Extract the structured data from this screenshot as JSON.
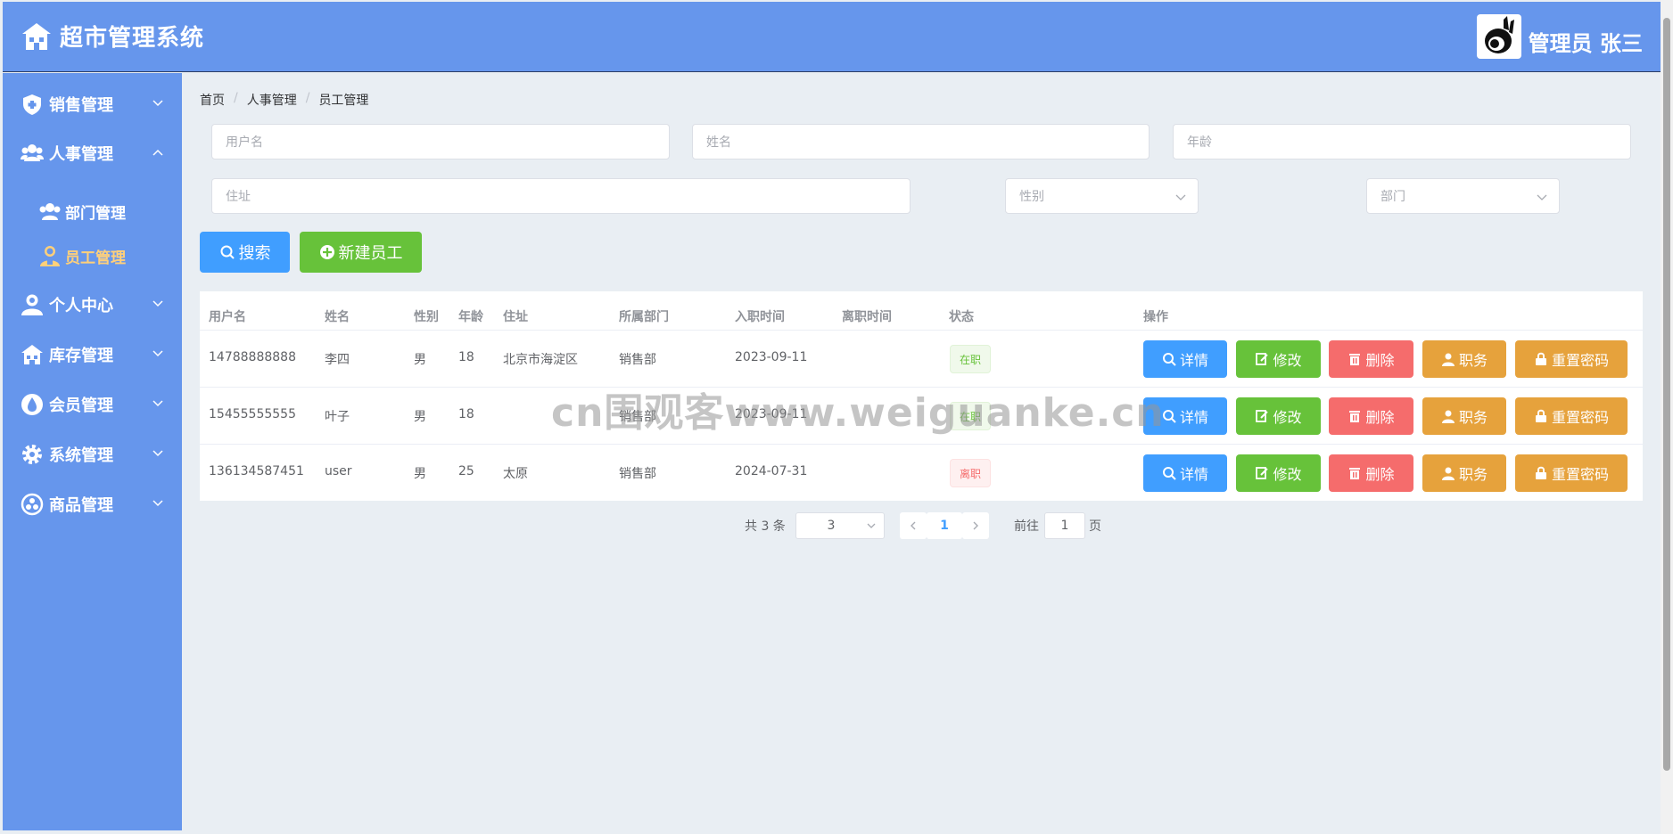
{
  "header": {
    "title": "超市管理系统",
    "user_name": "管理员 张三",
    "home_icon": "home-icon",
    "avatar_icon": "penguin-avatar"
  },
  "sidebar": {
    "items": [
      {
        "label": "销售管理",
        "icon": "shield-icon"
      },
      {
        "label": "人事管理",
        "icon": "people-icon"
      },
      {
        "label": "个人中心",
        "icon": "user-icon"
      },
      {
        "label": "库存管理",
        "icon": "warehouse-icon"
      },
      {
        "label": "会员管理",
        "icon": "drop-icon"
      },
      {
        "label": "系统管理",
        "icon": "gear-icon"
      },
      {
        "label": "商品管理",
        "icon": "goods-icon"
      }
    ],
    "sub_items": [
      {
        "label": "部门管理",
        "icon": "group-icon"
      },
      {
        "label": "员工管理",
        "icon": "employee-icon"
      }
    ]
  },
  "breadcrumb": [
    "首页",
    "人事管理",
    "员工管理"
  ],
  "filters": {
    "username_placeholder": "用户名",
    "name_placeholder": "姓名",
    "age_placeholder": "年龄",
    "address_placeholder": "住址",
    "gender_placeholder": "性别",
    "department_placeholder": "部门"
  },
  "buttons": {
    "search": "搜索",
    "new_employee": "新建员工"
  },
  "table": {
    "headers": [
      "用户名",
      "姓名",
      "性别",
      "年龄",
      "住址",
      "所属部门",
      "入职时间",
      "离职时间",
      "状态",
      "操作"
    ],
    "rows": [
      {
        "username": "14788888888",
        "name": "李四",
        "gender": "男",
        "age": "18",
        "address": "北京市海淀区",
        "department": "销售部",
        "hire_date": "2023-09-11",
        "leave_date": "",
        "status": "在职"
      },
      {
        "username": "15455555555",
        "name": "叶子",
        "gender": "男",
        "age": "18",
        "address": "",
        "department": "销售部",
        "hire_date": "2023-09-11",
        "leave_date": "",
        "status": "在职"
      },
      {
        "username": "136134587451",
        "name": "user",
        "gender": "男",
        "age": "25",
        "address": "太原",
        "department": "销售部",
        "hire_date": "2024-07-31",
        "leave_date": "",
        "status": "离职"
      }
    ],
    "actions": [
      "详情",
      "修改",
      "删除",
      "职务",
      "重置密码"
    ]
  },
  "pagination": {
    "total": "共 3 条",
    "page_size": "3",
    "current": "1",
    "goto_prefix": "前往",
    "goto_value": "1",
    "goto_suffix": "页"
  },
  "watermark": "cn围观客www.weiguanke.cn",
  "colors": {
    "header_bg": "#6696ec",
    "primary": "#409eff",
    "success": "#67c23a",
    "danger": "#f56c6c",
    "warning": "#e6a23c"
  }
}
